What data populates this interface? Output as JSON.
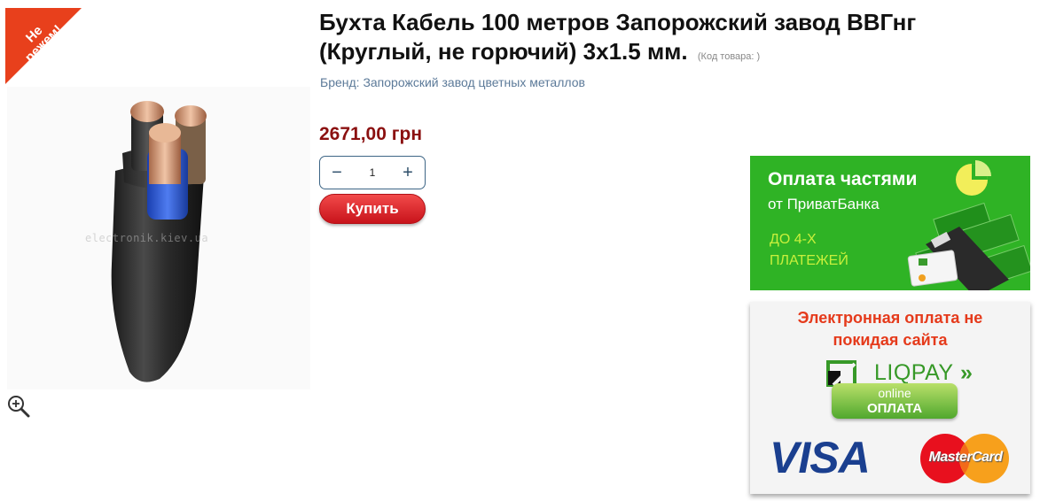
{
  "badge": {
    "line1": "Не",
    "line2": "режем!",
    "color": "#e8401c"
  },
  "product": {
    "title": "Бухта Кабель 100 метров Запорожский завод ВВГнг (Круглый, не горючий) 3х1.5 мм.",
    "sku_label": "(Код товара: )",
    "brand": "Бренд: Запорожский завод цветных металлов",
    "price": "2671,00 грн",
    "price_color": "#8b1010",
    "image_watermark": "electronik.kiev.ua"
  },
  "quantity": {
    "minus": "−",
    "value": "1",
    "plus": "+"
  },
  "buy_button": {
    "label": "Купить",
    "color": "#d91f26"
  },
  "zoom_icon": "zoom-in-icon",
  "banner_privat": {
    "title": "Оплата частями",
    "subtitle": "от ПриватБанка",
    "line1": "ДО 4-Х",
    "line2": "ПЛАТЕЖЕЙ",
    "bg_color": "#2fb325"
  },
  "banner_liqpay": {
    "title_line1": "Электронная оплата не",
    "title_line2": "покидая сайта",
    "liqpay": "LIQPAY",
    "pill_online": "online",
    "pill_oplata": "ОПЛАТА",
    "visa": "VISA",
    "mastercard": "MasterCard"
  }
}
